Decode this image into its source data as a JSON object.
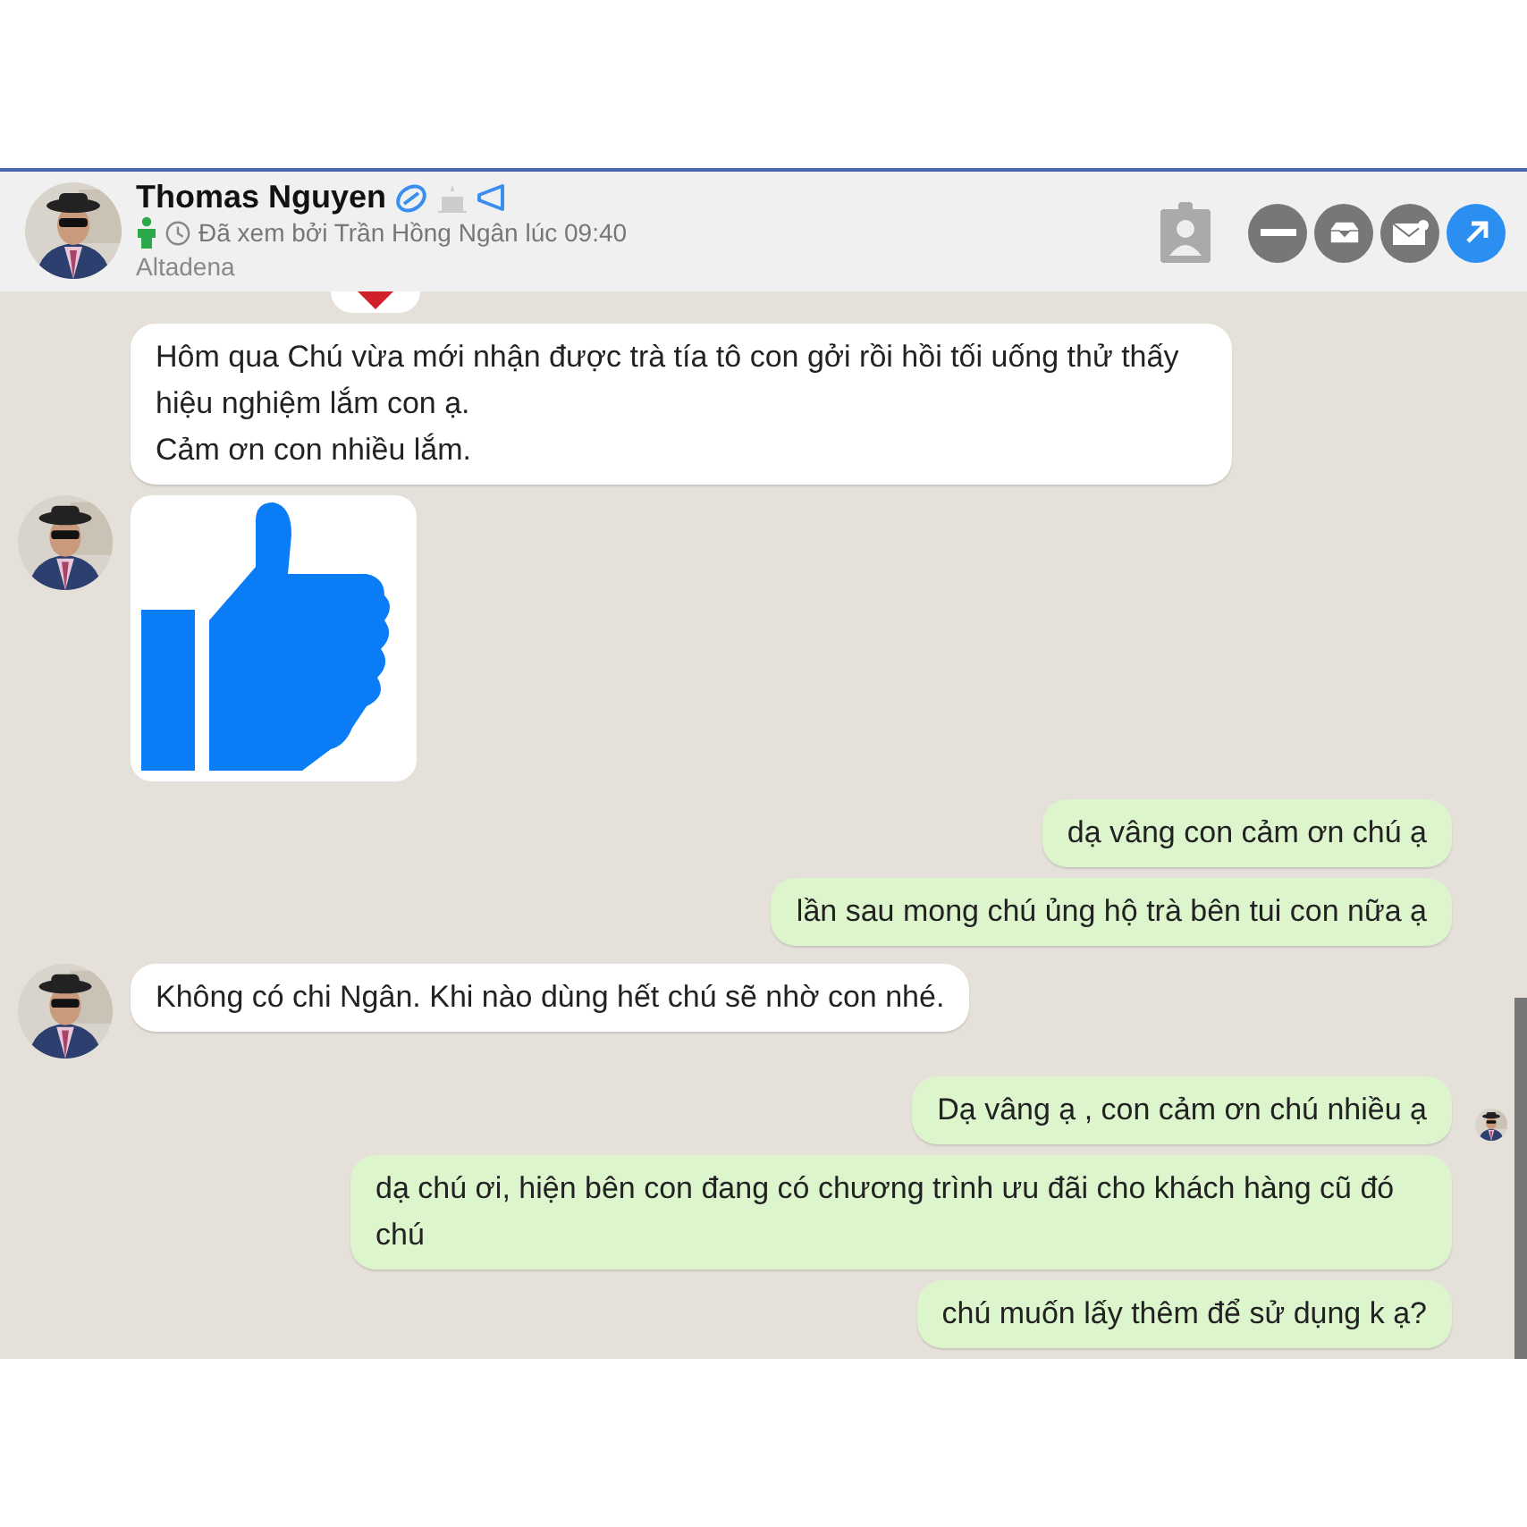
{
  "header": {
    "name": "Thomas Nguyen",
    "seen": "Đã xem bởi Trần Hồng Ngân lúc 09:40",
    "location": "Altadena"
  },
  "messages": [
    {
      "outgoing": false,
      "kind": "text",
      "avatar": false,
      "text": "Hôm qua Chú vừa mới nhận được trà tía tô con gởi rồi hồi tối uống thử thấy hiệu nghiệm lắm con ạ.\nCảm ơn con nhiều lắm."
    },
    {
      "outgoing": false,
      "kind": "sticker",
      "avatar": true
    },
    {
      "outgoing": true,
      "kind": "text",
      "avatar": false,
      "text": "dạ vâng con cảm ơn chú ạ"
    },
    {
      "outgoing": true,
      "kind": "text",
      "avatar": false,
      "text": "lần sau mong chú ủng hộ trà bên tui con nữa ạ"
    },
    {
      "outgoing": false,
      "kind": "text",
      "avatar": true,
      "text": "Không có chi Ngân. Khi nào dùng hết chú sẽ nhờ con nhé."
    },
    {
      "outgoing": true,
      "kind": "text",
      "avatar": true,
      "text": "Dạ vâng ạ , con cảm ơn chú nhiều ạ"
    },
    {
      "outgoing": true,
      "kind": "text",
      "avatar": false,
      "text": "dạ chú ơi, hiện bên con đang có chương trình ưu đãi cho khách hàng cũ đó chú"
    },
    {
      "outgoing": true,
      "kind": "text",
      "avatar": false,
      "text": "chú muốn lấy thêm để sử dụng k ạ?"
    }
  ]
}
